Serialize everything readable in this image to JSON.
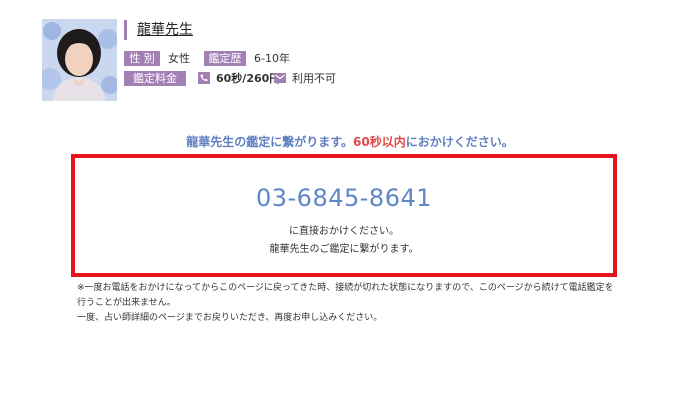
{
  "profile": {
    "name": "龍華先生",
    "gender_label": "性 別",
    "gender_value": "女性",
    "experience_label": "鑑定歴",
    "experience_value": "6-10年",
    "fee_label": "鑑定料金",
    "fee_value": "60秒/260円",
    "mail_status": "利用不可",
    "avatar_icon": "fortune-teller-portrait"
  },
  "notice": {
    "prefix": "龍華先生の鑑定に繋がります。",
    "highlight": "60秒以内",
    "suffix": "におかけください。"
  },
  "call_box": {
    "phone_number": "03-6845-8641",
    "line1": "に直接おかけください。",
    "line2": "龍華先生のご鑑定に繋がります。"
  },
  "footnote": {
    "line1": "※一度お電話をおかけになってからこのページに戻ってきた時、接続が切れた状態になりますので、このページから続けて電話鑑定を",
    "line2": "行うことが出来ません。",
    "line3": "一度、占い師詳細のページまでお戻りいただき、再度お申し込みください。"
  },
  "colors": {
    "accent_purple": "#a27fb4",
    "link_blue": "#5f86c6",
    "highlight_red": "#e34848",
    "box_border_red": "#e8141d"
  }
}
